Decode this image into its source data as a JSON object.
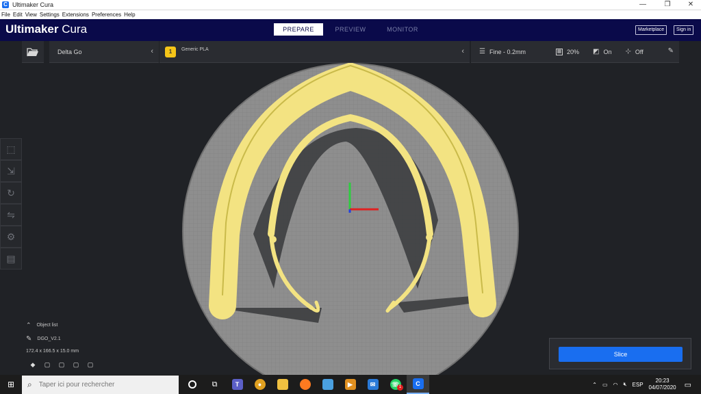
{
  "window": {
    "title": "Ultimaker Cura",
    "controls": [
      "—",
      "❐",
      "✕"
    ]
  },
  "menu": [
    "File",
    "Edit",
    "View",
    "Settings",
    "Extensions",
    "Preferences",
    "Help"
  ],
  "header": {
    "brand_bold": "Ultimaker",
    "brand_light": " Cura",
    "tabs": [
      "PREPARE",
      "PREVIEW",
      "MONITOR"
    ],
    "active_tab": "PREPARE",
    "marketplace": "Marketplace",
    "signin": "Sign in"
  },
  "printer": {
    "name": "Delta Go"
  },
  "material": {
    "badge": "1",
    "name": "Generic PLA"
  },
  "profile": {
    "quality": "Fine - 0.2mm",
    "infill": "20%",
    "support": "On",
    "adhesion": "Off"
  },
  "object_list": {
    "label": "Object list",
    "object_name": "DGO_V2.1",
    "dimensions": "172.4 x 166.5 x 15.0 mm"
  },
  "slice": {
    "label": "Slice"
  },
  "taskbar": {
    "search_placeholder": "Taper ici pour rechercher",
    "lang": "ESP",
    "time": "20:23",
    "date": "04/07/2020",
    "whatsapp_badge": "1"
  },
  "colors": {
    "accent": "#196ef0",
    "header_bg": "#0a0a4a",
    "model_yellow": "#f7e98a",
    "build_plate": "#8c8c8c"
  }
}
